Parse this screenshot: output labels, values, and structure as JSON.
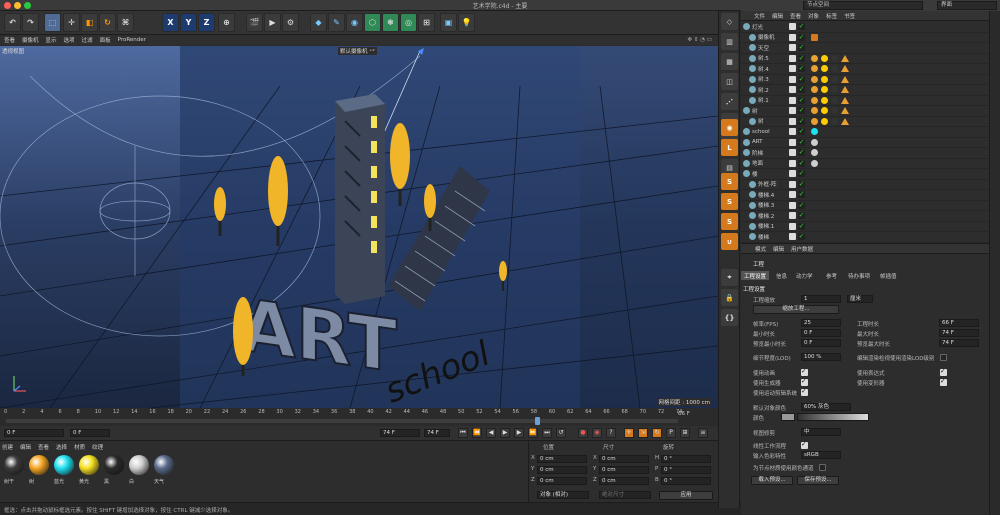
{
  "app": {
    "title": "艺术学院.c4d - 主要",
    "node_space": "节点空间",
    "layout": "界面"
  },
  "toolbar": {
    "axis_x": "X",
    "axis_y": "Y",
    "axis_z": "Z"
  },
  "viewport": {
    "menu": [
      "查看",
      "摄像机",
      "显示",
      "选项",
      "过滤",
      "面板",
      "ProRender"
    ],
    "mode_label": "透视视图",
    "camera_label": "默认摄像机 ⁺°",
    "grid_distance": "网格间距 : 1000 cm",
    "scene_text_art": "ART",
    "scene_text_school": "school"
  },
  "objects": {
    "menu": [
      "文件",
      "编辑",
      "查看",
      "对象",
      "标签",
      "书签"
    ],
    "rows": [
      {
        "name": "灯光",
        "indent": 0
      },
      {
        "name": "摄像机",
        "indent": 1
      },
      {
        "name": "天空",
        "indent": 1
      },
      {
        "name": "树.5",
        "indent": 1
      },
      {
        "name": "树.4",
        "indent": 1
      },
      {
        "name": "树.3",
        "indent": 1
      },
      {
        "name": "树.2",
        "indent": 1
      },
      {
        "name": "树.1",
        "indent": 1
      },
      {
        "name": "树",
        "indent": 0
      },
      {
        "name": "树",
        "indent": 1
      },
      {
        "name": "school",
        "indent": 0
      },
      {
        "name": "ART",
        "indent": 0
      },
      {
        "name": "阶梯",
        "indent": 0
      },
      {
        "name": "地面",
        "indent": 0
      },
      {
        "name": "楼",
        "indent": 0
      },
      {
        "name": "外框-阵",
        "indent": 1
      },
      {
        "name": "楼梯.4",
        "indent": 1
      },
      {
        "name": "楼梯.3",
        "indent": 1
      },
      {
        "name": "楼梯.2",
        "indent": 1
      },
      {
        "name": "楼梯.1",
        "indent": 1
      },
      {
        "name": "楼梯",
        "indent": 1
      }
    ]
  },
  "attributes": {
    "menu": [
      "模式",
      "编辑",
      "用户数据"
    ],
    "object_name": "工程",
    "tabs": [
      "工程设置",
      "信息",
      "动力学",
      "参考",
      "待办事项",
      "帧插值"
    ],
    "section": "工程设置",
    "scale_label": "工程缩放",
    "scale_value": "1",
    "scale_unit": "厘米",
    "scale_button": "缩放工程...",
    "fps_label": "帧率(FPS)",
    "fps_value": "25",
    "duration_label": "工程时长",
    "duration_value": "66 F",
    "min_time_label": "最小时长",
    "min_time_value": "0 F",
    "max_time_label": "最大时长",
    "max_time_value": "74 F",
    "preview_min_label": "预览最小时长",
    "preview_min_value": "0 F",
    "preview_max_label": "预览最大时长",
    "preview_max_value": "74 F",
    "lod_label": "细节程度(LOD)",
    "lod_value": "100 %",
    "lod_editor_label": "编辑渲染检视使用渲染LOD级别",
    "use_anim": "使用动画",
    "use_expr": "使用表达式",
    "use_gen": "使用生成器",
    "use_deform": "使用变形器",
    "use_motion": "使用运动剪辑系统",
    "default_color_label": "默认对象颜色",
    "default_color_value": "60% 灰色",
    "color_label": "颜色",
    "view_clip_label": "视图修剪",
    "view_clip_value": "中",
    "linear_label": "线性工作流程",
    "input_color_label": "输入色彩特性",
    "input_color_value": "sRGB",
    "node_color_label": "为节点材质使用颜色通道",
    "load_preset": "载入预设...",
    "save_preset": "保存预设..."
  },
  "timeline": {
    "ticks": [
      "0",
      "2",
      "4",
      "6",
      "8",
      "10",
      "12",
      "14",
      "16",
      "18",
      "20",
      "22",
      "24",
      "26",
      "28",
      "30",
      "32",
      "34",
      "36",
      "38",
      "40",
      "42",
      "44",
      "46",
      "48",
      "50",
      "52",
      "54",
      "56",
      "58",
      "60",
      "62",
      "64",
      "66",
      "68",
      "70",
      "72",
      "74"
    ],
    "end_label": "66 F",
    "current_frame": "0 F",
    "min_field": "0 F",
    "max_field": "74 F",
    "max_field2": "74 F",
    "playhead_fraction": 0.79
  },
  "materials": {
    "menu": [
      "创建",
      "编辑",
      "查看",
      "选择",
      "材质",
      "纹理"
    ],
    "items": [
      {
        "label": "树干",
        "color": "#3a3a3a"
      },
      {
        "label": "树",
        "color": "#f5a623"
      },
      {
        "label": "蓝光",
        "color": "#1ee0f0"
      },
      {
        "label": "黄光",
        "color": "#f5e020"
      },
      {
        "label": "黑",
        "color": "#2a2a2a"
      },
      {
        "label": "白",
        "color": "#cfcfcf"
      },
      {
        "label": "天气",
        "color": "#5a6a8a"
      }
    ]
  },
  "coords": {
    "position": "位置",
    "size": "尺寸",
    "rotation": "旋转",
    "rows": [
      {
        "axis": "X",
        "pos": "0 cm",
        "sz_axis": "X",
        "size": "0 cm",
        "rot_axis": "H",
        "rot": "0 °"
      },
      {
        "axis": "Y",
        "pos": "0 cm",
        "sz_axis": "Y",
        "size": "0 cm",
        "rot_axis": "P",
        "rot": "0 °"
      },
      {
        "axis": "Z",
        "pos": "0 cm",
        "sz_axis": "Z",
        "size": "0 cm",
        "rot_axis": "B",
        "rot": "0 °"
      }
    ],
    "mode": "对象 (相对)",
    "size_mode": "绝对尺寸",
    "apply": "应用"
  },
  "status": {
    "text": "框选：点击并拖动鼠标框选元素。按住 SHIFT 键增加选择对象，按住 CTRL 键减少选择对象。"
  }
}
